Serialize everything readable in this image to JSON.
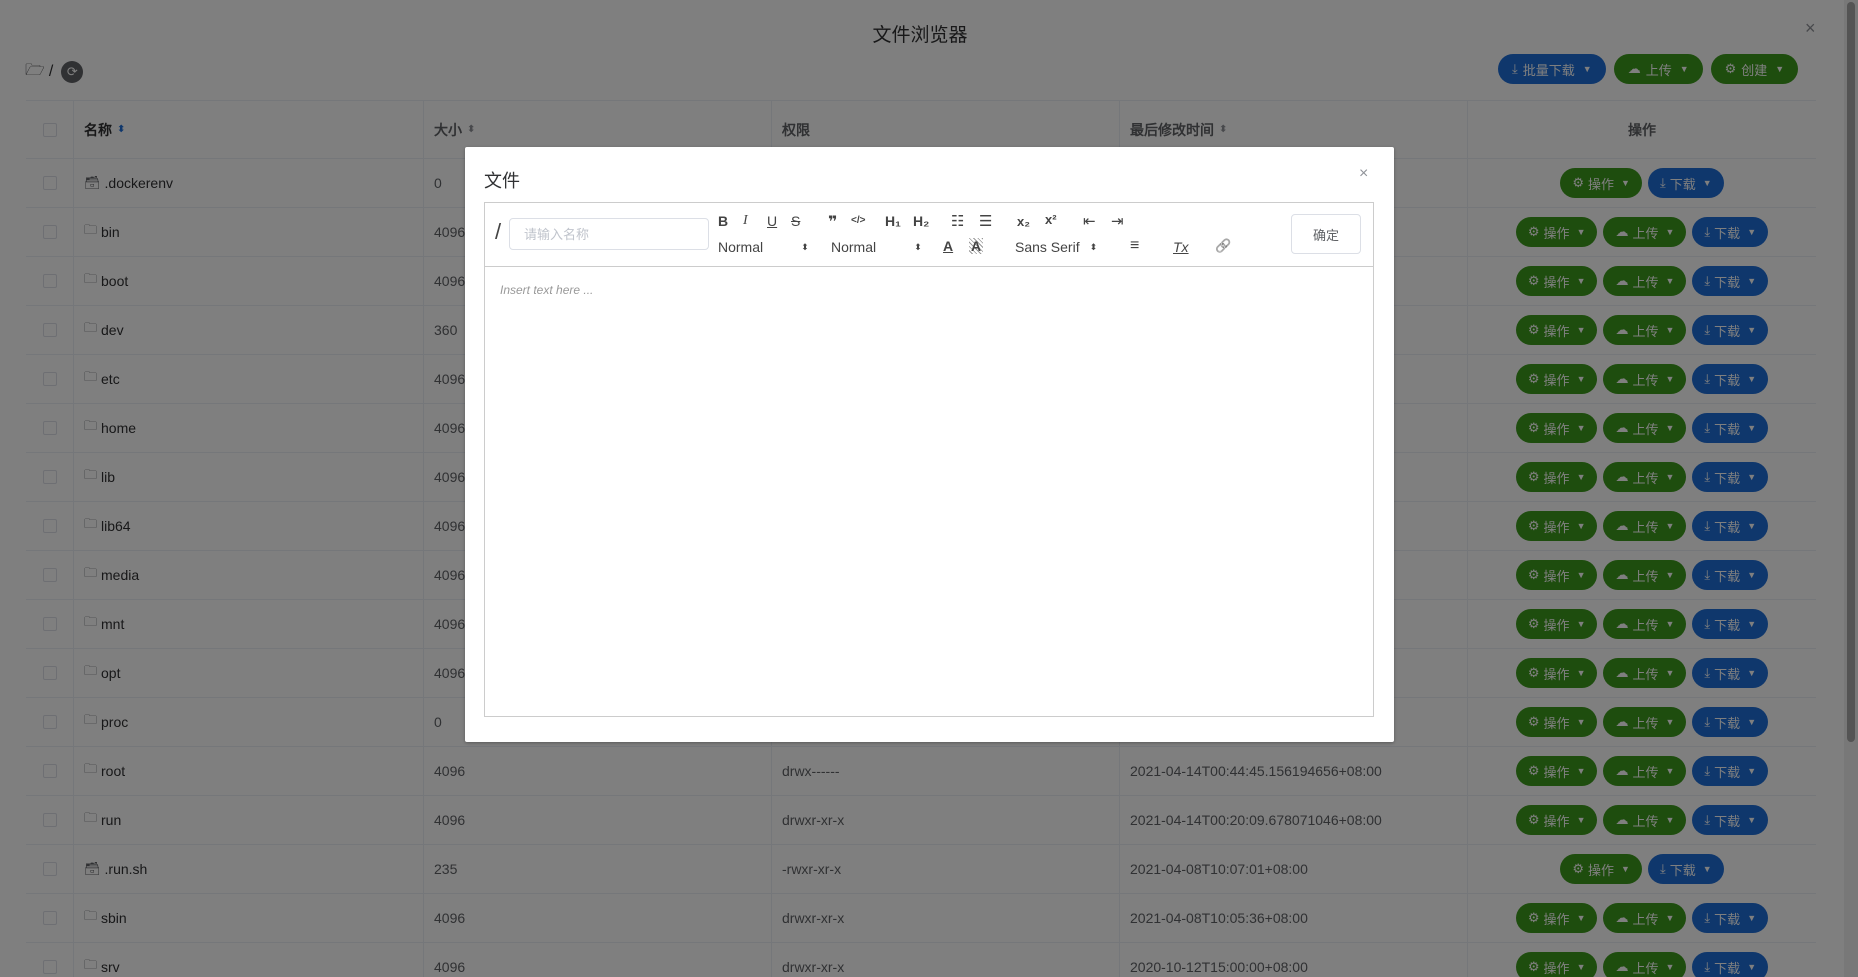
{
  "page": {
    "title": "文件浏览器",
    "path": "/",
    "close_glyph": "×"
  },
  "top_actions": {
    "batch_download": "批量下载",
    "upload": "上传",
    "create": "创建"
  },
  "table": {
    "headers": {
      "name": "名称",
      "size": "大小",
      "permission": "权限",
      "modified": "最后修改时间",
      "actions": "操作"
    },
    "rows": [
      {
        "name": "dockerenv",
        "size": "0",
        "perm": "",
        "modified": "",
        "is_dir": false
      },
      {
        "name": "bin",
        "size": "4096",
        "perm": "",
        "modified": "",
        "is_dir": true
      },
      {
        "name": "boot",
        "size": "4096",
        "perm": "",
        "modified": "",
        "is_dir": true
      },
      {
        "name": "dev",
        "size": "360",
        "perm": "",
        "modified": "",
        "is_dir": true
      },
      {
        "name": "etc",
        "size": "4096",
        "perm": "",
        "modified": "",
        "is_dir": true
      },
      {
        "name": "home",
        "size": "4096",
        "perm": "",
        "modified": "",
        "is_dir": true
      },
      {
        "name": "lib",
        "size": "4096",
        "perm": "",
        "modified": "",
        "is_dir": true
      },
      {
        "name": "lib64",
        "size": "4096",
        "perm": "",
        "modified": "",
        "is_dir": true
      },
      {
        "name": "media",
        "size": "4096",
        "perm": "",
        "modified": "",
        "is_dir": true
      },
      {
        "name": "mnt",
        "size": "4096",
        "perm": "",
        "modified": "",
        "is_dir": true
      },
      {
        "name": "opt",
        "size": "4096",
        "perm": "",
        "modified": "",
        "is_dir": true
      },
      {
        "name": "proc",
        "size": "0",
        "perm": "",
        "modified": "",
        "is_dir": true
      },
      {
        "name": "root",
        "size": "4096",
        "perm": "drwx------",
        "modified": "2021-04-14T00:44:45.156194656+08:00",
        "is_dir": true
      },
      {
        "name": "run",
        "size": "4096",
        "perm": "drwxr-xr-x",
        "modified": "2021-04-14T00:20:09.678071046+08:00",
        "is_dir": true
      },
      {
        "name": "run.sh",
        "size": "235",
        "perm": "-rwxr-xr-x",
        "modified": "2021-04-08T10:07:01+08:00",
        "is_dir": false
      },
      {
        "name": "sbin",
        "size": "4096",
        "perm": "drwxr-xr-x",
        "modified": "2021-04-08T10:05:36+08:00",
        "is_dir": true
      },
      {
        "name": "srv",
        "size": "4096",
        "perm": "drwxr-xr-x",
        "modified": "2020-10-12T15:00:00+08:00",
        "is_dir": true
      }
    ],
    "row_actions": {
      "operate": "操作",
      "upload": "上传",
      "download": "下载"
    }
  },
  "modal": {
    "title": "文件",
    "close_glyph": "×",
    "path_prefix": "/",
    "name_placeholder": "请输入名称",
    "confirm": "确定",
    "toolbar": {
      "bold": "B",
      "italic": "I",
      "underline": "U",
      "strike": "S",
      "quote": "❞",
      "code": "</>",
      "h1": "H₁",
      "h2": "H₂",
      "ordered_list": "☷",
      "bullet_list": "☰",
      "subscript": "x₂",
      "superscript": "x²",
      "outdent": "⇤",
      "indent": "⇥",
      "size_select": "Normal",
      "header_select": "Normal",
      "font_color": "A",
      "background": "A",
      "font_select": "Sans Serif",
      "align": "≡",
      "clean": "Tx",
      "link": "🔗"
    },
    "editor_placeholder": "Insert text here ..."
  },
  "colors": {
    "blue": "#1f6fd8",
    "green": "#3c9a1c",
    "overlay": "rgba(0,0,0,0.5)"
  }
}
